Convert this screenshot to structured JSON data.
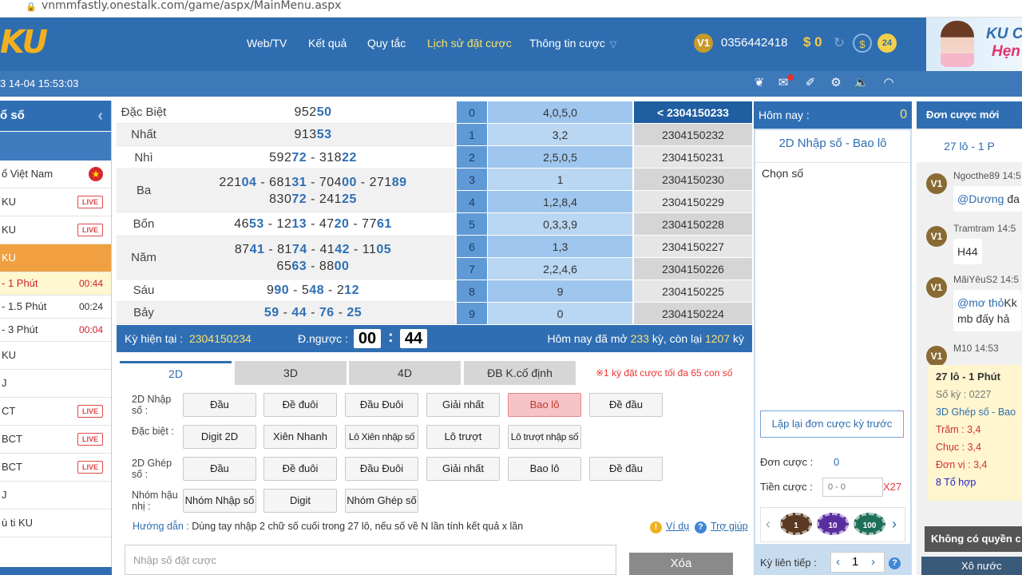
{
  "browser": {
    "url": "vnmmfastly.onestalk.com/game/aspx/MainMenu.aspx"
  },
  "header": {
    "logo": "KU",
    "nav": [
      {
        "label": "Web/TV"
      },
      {
        "label": "Kết quả"
      },
      {
        "label": "Quy tắc"
      },
      {
        "label": "Lịch sử đặt cược"
      },
      {
        "label": "Thông tin cược"
      }
    ],
    "vip": "V1",
    "phone": "0356442418",
    "balance": "$ 0",
    "badge_count": "24",
    "banner_line1": "KU C",
    "banner_line2": "Hẹn"
  },
  "subbar": {
    "clock": "3 14-04 15:53:03"
  },
  "sidebar": {
    "title": "ổ số",
    "items": [
      {
        "label": "ổ Việt Nam"
      },
      {
        "label": "KU",
        "badge": "LIVE"
      },
      {
        "label": "KU",
        "badge": "LIVE"
      },
      {
        "label": "KU"
      },
      {
        "label": "- 1 Phút",
        "time": "00:44"
      },
      {
        "label": "- 1.5 Phút",
        "time": "00:24"
      },
      {
        "label": "- 3 Phút",
        "time": "00:04"
      },
      {
        "label": "KU"
      },
      {
        "label": "J"
      },
      {
        "label": "CT",
        "badge": "LIVE"
      },
      {
        "label": "BCT",
        "badge": "LIVE"
      },
      {
        "label": "BCT",
        "badge": "LIVE"
      },
      {
        "label": "J"
      },
      {
        "label": "ù ti KU"
      }
    ]
  },
  "results": [
    {
      "prize": "Đặc Biệt",
      "lines": [
        [
          {
            "a": "952",
            "b": "50"
          }
        ]
      ]
    },
    {
      "prize": "Nhất",
      "lines": [
        [
          {
            "a": "913",
            "b": "53"
          }
        ]
      ]
    },
    {
      "prize": "Nhì",
      "lines": [
        [
          {
            "a": "592",
            "b": "72"
          },
          {
            "a": "318",
            "b": "22"
          }
        ]
      ]
    },
    {
      "prize": "Ba",
      "lines": [
        [
          {
            "a": "221",
            "b": "04"
          },
          {
            "a": "681",
            "b": "31"
          },
          {
            "a": "704",
            "b": "00"
          },
          {
            "a": "271",
            "b": "89"
          }
        ],
        [
          {
            "a": "830",
            "b": "72"
          },
          {
            "a": "241",
            "b": "25"
          }
        ]
      ]
    },
    {
      "prize": "Bốn",
      "lines": [
        [
          {
            "a": "46",
            "b": "53"
          },
          {
            "a": "12",
            "b": "13"
          },
          {
            "a": "47",
            "b": "20"
          },
          {
            "a": "77",
            "b": "61"
          }
        ]
      ]
    },
    {
      "prize": "Năm",
      "lines": [
        [
          {
            "a": "87",
            "b": "41"
          },
          {
            "a": "81",
            "b": "74"
          },
          {
            "a": "41",
            "b": "42"
          },
          {
            "a": "11",
            "b": "05"
          }
        ],
        [
          {
            "a": "65",
            "b": "63"
          },
          {
            "a": "88",
            "b": "00"
          }
        ]
      ]
    },
    {
      "prize": "Sáu",
      "lines": [
        [
          {
            "a": "9",
            "b": "90"
          },
          {
            "a": "5",
            "b": "48"
          },
          {
            "a": "2",
            "b": "12"
          }
        ]
      ]
    },
    {
      "prize": "Bảy",
      "lines": [
        [
          {
            "a": "",
            "b": "59"
          },
          {
            "a": "",
            "b": "44"
          },
          {
            "a": "",
            "b": "76"
          },
          {
            "a": "",
            "b": "25"
          }
        ]
      ]
    }
  ],
  "loto": [
    {
      "d": "0",
      "v": "4,0,5,0"
    },
    {
      "d": "1",
      "v": "3,2"
    },
    {
      "d": "2",
      "v": "2,5,0,5"
    },
    {
      "d": "3",
      "v": "1"
    },
    {
      "d": "4",
      "v": "1,2,8,4"
    },
    {
      "d": "5",
      "v": "0,3,3,9"
    },
    {
      "d": "6",
      "v": "1,3"
    },
    {
      "d": "7",
      "v": "2,2,4,6"
    },
    {
      "d": "8",
      "v": "9"
    },
    {
      "d": "9",
      "v": "0"
    }
  ],
  "draws": [
    "< 2304150233",
    "2304150232",
    "2304150231",
    "2304150230",
    "2304150229",
    "2304150228",
    "2304150227",
    "2304150226",
    "2304150225",
    "2304150224"
  ],
  "kybar": {
    "current_label": "Kỳ hiện tại :",
    "current": "2304150234",
    "countdown_label": "Đ.ngược :",
    "mm": "00",
    "ss": "44",
    "today_pre": "Hôm nay đã mở",
    "today_open": "233",
    "today_mid": "kỳ, còn lại",
    "today_left": "1207",
    "today_post": "kỳ"
  },
  "tabs": [
    "2D",
    "3D",
    "4D",
    "ĐB K.cố định"
  ],
  "tab_note": "※1 kỳ đặt cược tối đa 65 con số",
  "groups": [
    {
      "label": "2D Nhập số :",
      "buttons": [
        "Đầu",
        "Đề đuôi",
        "Đầu Đuôi",
        "Giải nhất",
        "Bao lô",
        "Đề đầu"
      ]
    },
    {
      "label": "Đặc biệt :",
      "buttons": [
        "Digit 2D",
        "Xiên Nhanh",
        "Lô Xiên nhập số",
        "Lô trượt",
        "Lô trượt nhập số"
      ]
    },
    {
      "label": "2D Ghép số :",
      "buttons": [
        "Đầu",
        "Đề đuôi",
        "Đầu Đuôi",
        "Giải nhất",
        "Bao lô",
        "Đề đầu"
      ]
    },
    {
      "label": "Nhóm hậu nhị :",
      "buttons": [
        "Nhóm Nhập số",
        "Digit",
        "Nhóm Ghép số"
      ]
    }
  ],
  "guide": {
    "label": "Hướng dẫn :",
    "text": "Dùng tay nhập 2 chữ số cuối trong 27 lô, nếu số về N lần tính kết quả x lần",
    "example": "Ví dụ",
    "help": "Trợ giúp"
  },
  "bet_input": {
    "placeholder": "Nhập số đặt cược"
  },
  "clear_button": "Xóa",
  "pick": {
    "today_label": "Hôm nay :",
    "today_count": "0",
    "title": "2D Nhập số - Bao lô",
    "choose": "Chọn số",
    "repeat": "Lặp lại đơn cược kỳ trước",
    "orders_label": "Đơn cược :",
    "orders": "0",
    "amount_label": "Tiền cược :",
    "amount_placeholder": "0 - 0",
    "multiplier": "X27",
    "chips": [
      "1",
      "10",
      "100"
    ],
    "streak_label": "Kỳ liên tiếp :",
    "streak": "1"
  },
  "feed": {
    "title": "Đơn cược mới",
    "sub": "27 lô - 1 P",
    "messages": [
      {
        "user": "Ngocthe89 14:5",
        "pre": "",
        "at": "@Dương",
        "text": " đa",
        "text2": ""
      },
      {
        "user": "Tramtram 14:5",
        "pre": "H44",
        "at": "",
        "text": "",
        "text2": ""
      },
      {
        "user": "MãiYêuS2 14:5",
        "pre": "",
        "at": "@mơ thỏ",
        "text": "Kk",
        "text2": "mb đấy hả"
      },
      {
        "user": "M10 14:53",
        "pre": "",
        "at": "",
        "text": "",
        "text2": ""
      }
    ],
    "card": {
      "title": "27 lô - 1 Phút",
      "ky": "Số kỳ : 0227",
      "type": "3D Ghép số - Bao",
      "tram": "Trăm : 3,4",
      "chuc": "Chục : 3,4",
      "donvi": "Đơn vị : 3,4",
      "combos": "8 Tổ hợp"
    },
    "noperm": "Không có quyền c",
    "dice": "Xô nước"
  },
  "colors": {
    "primary": "#2e6db0",
    "accent": "#f7e06e",
    "selected": "#f6c3c6",
    "live": "#e04848"
  }
}
